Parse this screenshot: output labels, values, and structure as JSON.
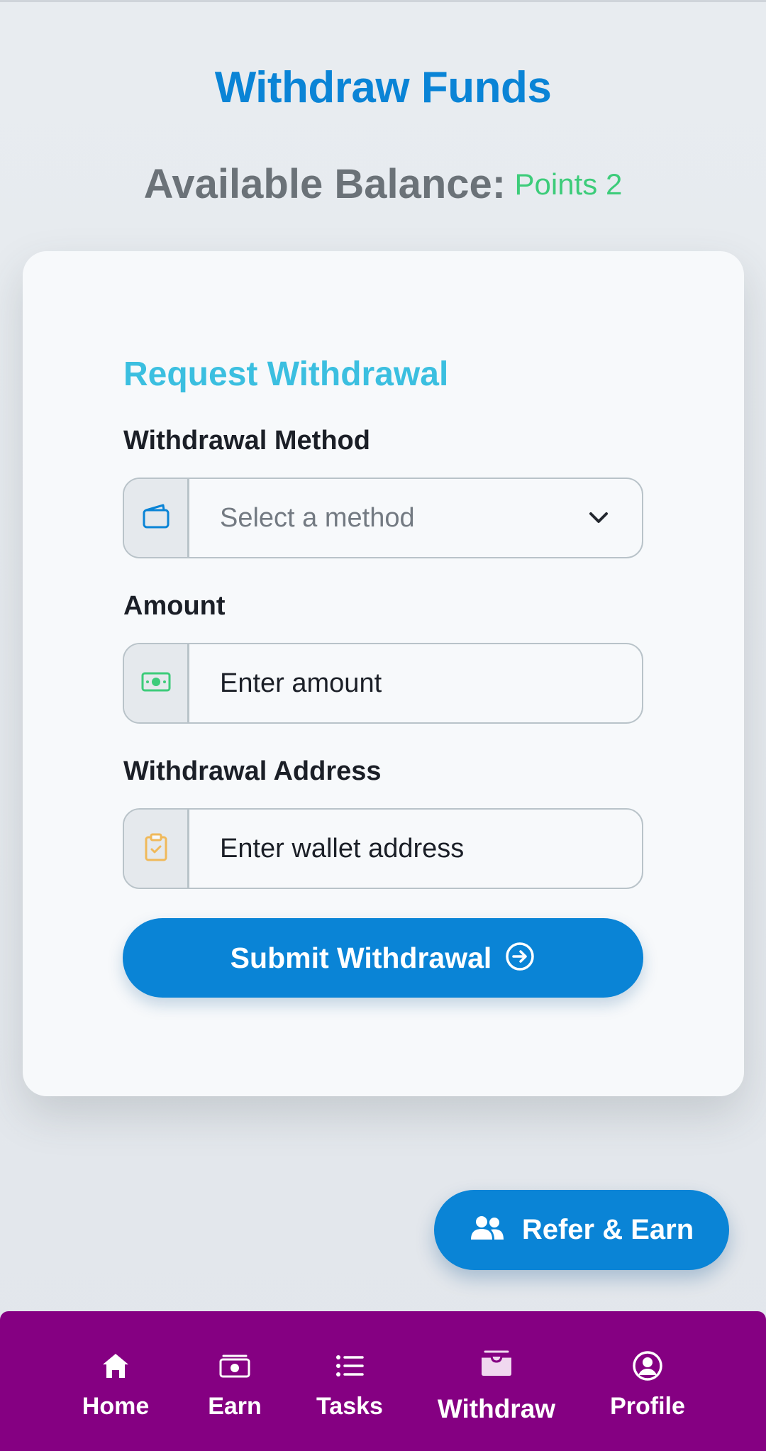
{
  "page": {
    "title": "Withdraw Funds",
    "balance_label": "Available Balance:",
    "balance_value": "Points 2"
  },
  "form": {
    "title": "Request Withdrawal",
    "method": {
      "label": "Withdrawal Method",
      "selected": "Select a method",
      "icon": "wallet-icon"
    },
    "amount": {
      "label": "Amount",
      "placeholder": "Enter amount",
      "icon": "cash-icon"
    },
    "address": {
      "label": "Withdrawal Address",
      "placeholder": "Enter wallet address",
      "icon": "clipboard-check-icon"
    },
    "submit_label": "Submit Withdrawal"
  },
  "refer_button": {
    "label": "Refer & Earn",
    "icon": "users-icon"
  },
  "nav": {
    "items": [
      {
        "label": "Home",
        "icon": "home-icon"
      },
      {
        "label": "Earn",
        "icon": "cash-icon"
      },
      {
        "label": "Tasks",
        "icon": "list-icon"
      },
      {
        "label": "Withdraw",
        "icon": "wallet-box-icon",
        "active": true
      },
      {
        "label": "Profile",
        "icon": "user-circle-icon"
      }
    ]
  },
  "colors": {
    "accent": "#0a84d6",
    "title": "#0a84d6",
    "balance_value": "#3dcc7a",
    "card_title": "#3bbfe0",
    "nav_background": "#850082"
  }
}
